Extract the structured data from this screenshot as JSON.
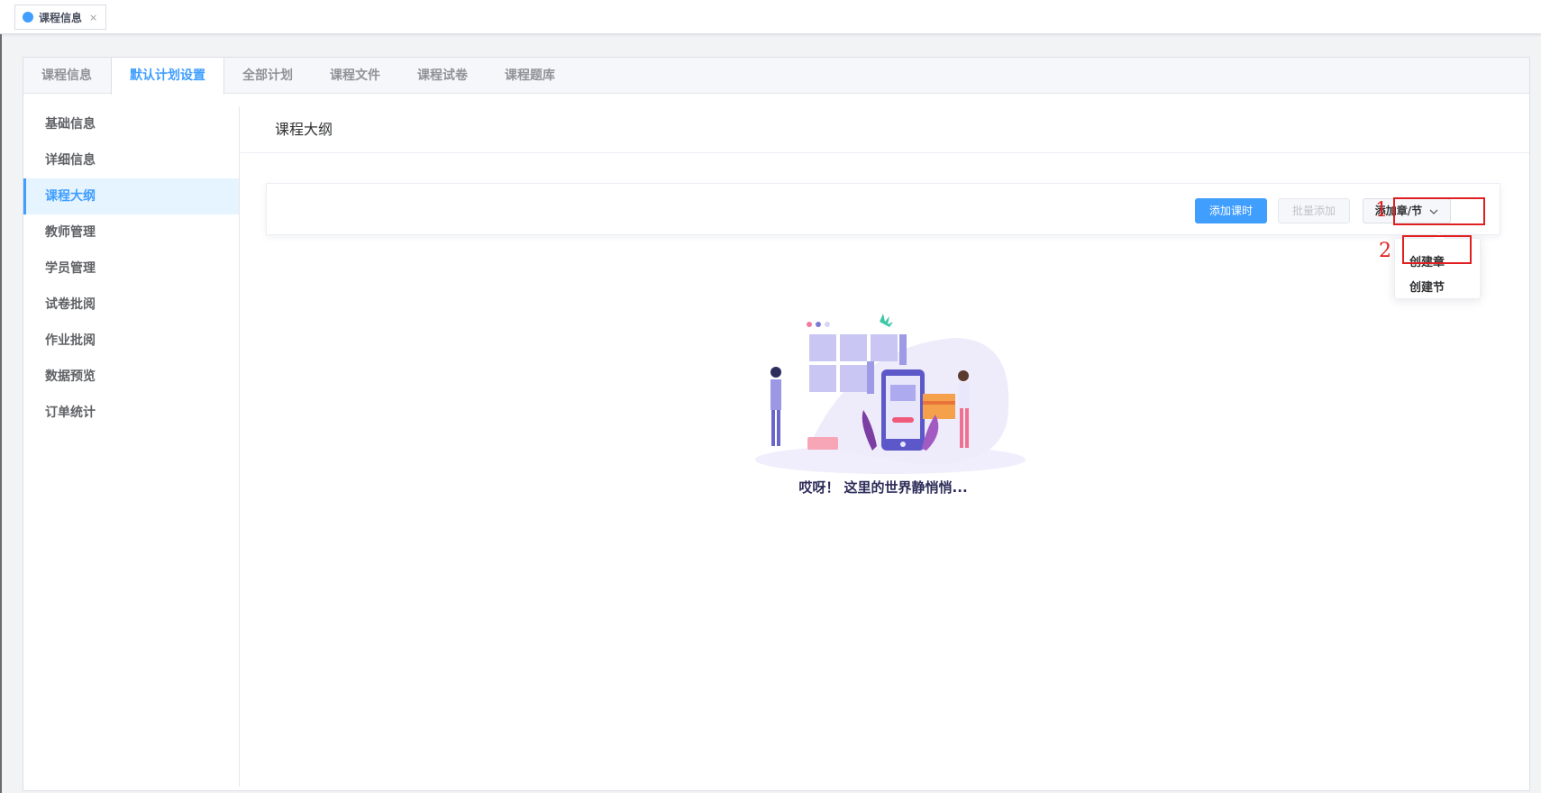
{
  "tagbar": {
    "tab_label": "课程信息",
    "close_glyph": "×"
  },
  "tabs": [
    {
      "label": "课程信息"
    },
    {
      "label": "默认计划设置"
    },
    {
      "label": "全部计划"
    },
    {
      "label": "课程文件"
    },
    {
      "label": "课程试卷"
    },
    {
      "label": "课程题库"
    }
  ],
  "sidebar": {
    "items": [
      {
        "label": "基础信息"
      },
      {
        "label": "详细信息"
      },
      {
        "label": "课程大纲"
      },
      {
        "label": "教师管理"
      },
      {
        "label": "学员管理"
      },
      {
        "label": "试卷批阅"
      },
      {
        "label": "作业批阅"
      },
      {
        "label": "数据预览"
      },
      {
        "label": "订单统计"
      }
    ]
  },
  "content": {
    "title": "课程大纲",
    "toolbar": {
      "add_lesson": "添加课时",
      "batch_add": "批量添加",
      "add_chapter": "添加章/节"
    },
    "dropdown": {
      "items": [
        "创建章",
        "创建节"
      ]
    },
    "empty_text": "哎呀！ 这里的世界静悄悄..."
  },
  "annotations": {
    "step1": "1",
    "step2": "2"
  },
  "colors": {
    "accent": "#409eff",
    "annotation": "#e02020"
  }
}
